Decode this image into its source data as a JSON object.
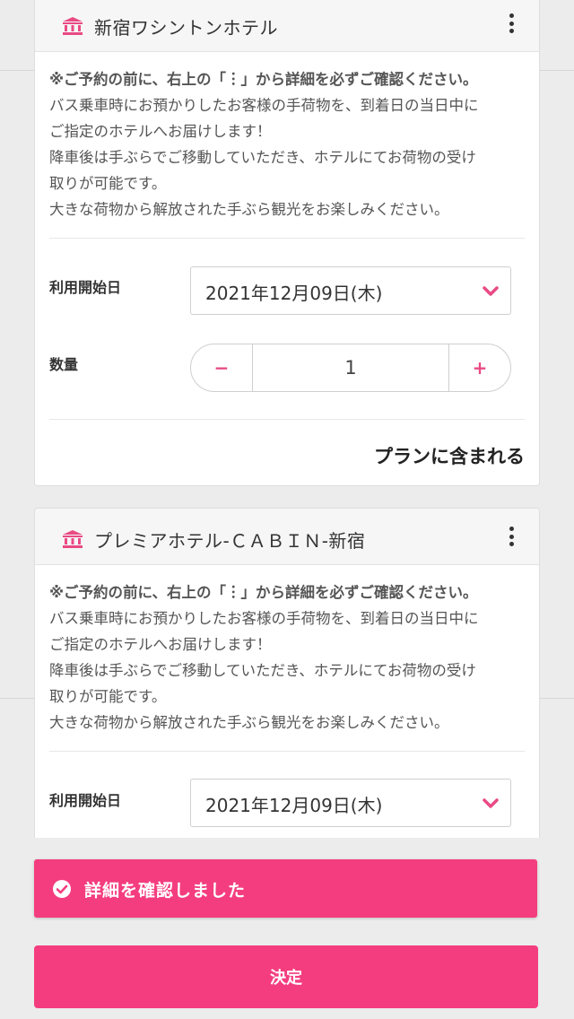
{
  "colors": {
    "accent": "#f43d7f",
    "accent_text": "#e94a84",
    "card_head_bg": "#f6f6f6"
  },
  "cards": [
    {
      "icon": "hotel-icon",
      "hotel_name": "新宿ワシントンホテル",
      "menu_icon": "kebab-menu-icon",
      "warning": "※ご予約の前に、右上の「︙」から詳細を必ずご確認ください。",
      "desc_lines": [
        "バス乗車時にお預かりしたお客様の手荷物を、到着日の当日中に",
        "ご指定のホテルへお届けします！",
        "降車後は手ぶらでご移動していただき、ホテルにてお荷物の受け",
        "取りが可能です。",
        "大きな荷物から解放された手ぶら観光をお楽しみください。"
      ],
      "date_label": "利用開始日",
      "date_value": "2021年12月09日(木)",
      "qty_label": "数量",
      "qty_minus": "−",
      "qty_value": "1",
      "qty_plus": "+",
      "included_text": "プランに含まれる"
    },
    {
      "icon": "hotel-icon",
      "hotel_name": "プレミアホテル-ＣＡＢＩＮ-新宿",
      "menu_icon": "kebab-menu-icon",
      "warning": "※ご予約の前に、右上の「︙」から詳細を必ずご確認ください。",
      "desc_lines": [
        "バス乗車時にお預かりしたお客様の手荷物を、到着日の当日中に",
        "ご指定のホテルへお届けします！",
        "降車後は手ぶらでご移動していただき、ホテルにてお荷物の受け",
        "取りが可能です。",
        "大きな荷物から解放された手ぶら観光をお楽しみください。"
      ],
      "date_label": "利用開始日",
      "date_value": "2021年12月09日(木)"
    }
  ],
  "confirm_bar": {
    "icon": "check-circle-icon",
    "label": "詳細を確認しました"
  },
  "submit": {
    "label": "決定"
  }
}
